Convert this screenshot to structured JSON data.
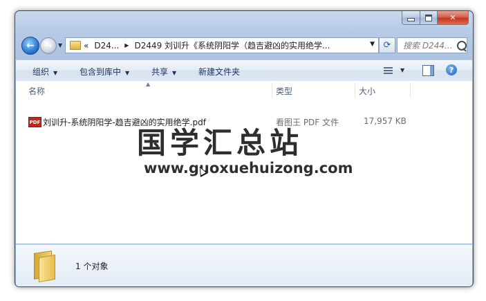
{
  "nav": {
    "address_prefix": "«",
    "address_seg1": "D24...",
    "address_seg2": "D2449 刘训升《系统阴阳学（趋吉避凶的实用绝学..."
  },
  "search": {
    "placeholder": "搜索 D244..."
  },
  "toolbar": {
    "organize": "组织",
    "include_library": "包含到库中",
    "share": "共享",
    "new_folder": "新建文件夹"
  },
  "columns": {
    "name": "名称",
    "type": "类型",
    "size": "大小"
  },
  "files": [
    {
      "name": "刘训升-系统阴阳学-趋吉避凶的实用绝学.pdf",
      "type": "看图王 PDF 文件",
      "size": "17,957 KB",
      "icon": "pdf-icon"
    }
  ],
  "watermark": {
    "text_cn": "国学汇总站",
    "url": "www.guoxuehuizong.com"
  },
  "details": {
    "count": "1 个对象"
  },
  "icon_labels": {
    "pdf": "PDF"
  }
}
